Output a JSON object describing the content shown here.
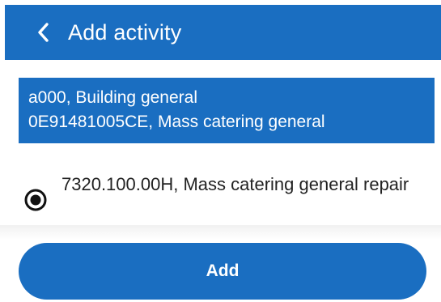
{
  "header": {
    "title": "Add activity",
    "back_icon": "chevron-left-icon"
  },
  "info": {
    "line1": "a000, Building general",
    "line2": "0E91481005CE, Mass catering general"
  },
  "option": {
    "label": "7320.100.00H, Mass catering general repair",
    "selected": true
  },
  "actions": {
    "add_label": "Add"
  },
  "colors": {
    "primary": "#1a6ec1",
    "on_primary": "#ffffff",
    "text": "#222222"
  }
}
